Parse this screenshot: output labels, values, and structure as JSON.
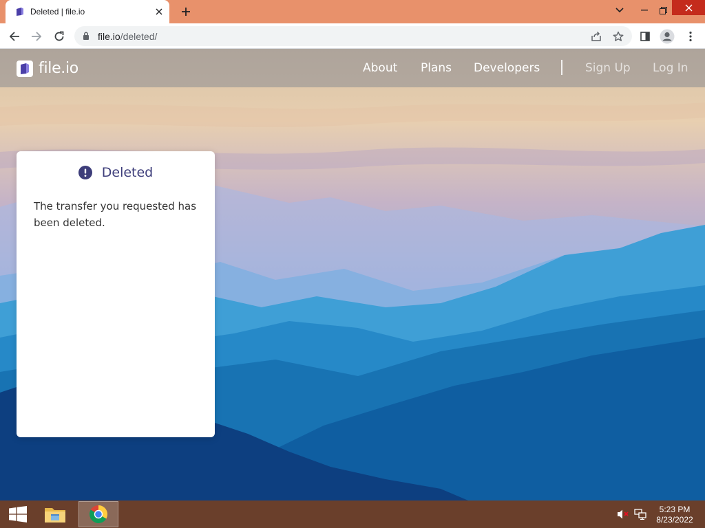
{
  "browser": {
    "tab_title": "Deleted | file.io",
    "url_host": "file.io",
    "url_path": "/deleted/"
  },
  "site": {
    "logo_text": "file.io",
    "nav": {
      "about": "About",
      "plans": "Plans",
      "developers": "Developers",
      "sign_up": "Sign Up",
      "log_in": "Log In"
    }
  },
  "card": {
    "title": "Deleted",
    "message": "The transfer you requested has been deleted."
  },
  "taskbar": {
    "time": "5:23 PM",
    "date": "8/23/2022"
  },
  "colors": {
    "chrome_frame": "#e8916b",
    "brand_purple": "#3d3d7a",
    "taskbar": "#6a3f2b"
  }
}
